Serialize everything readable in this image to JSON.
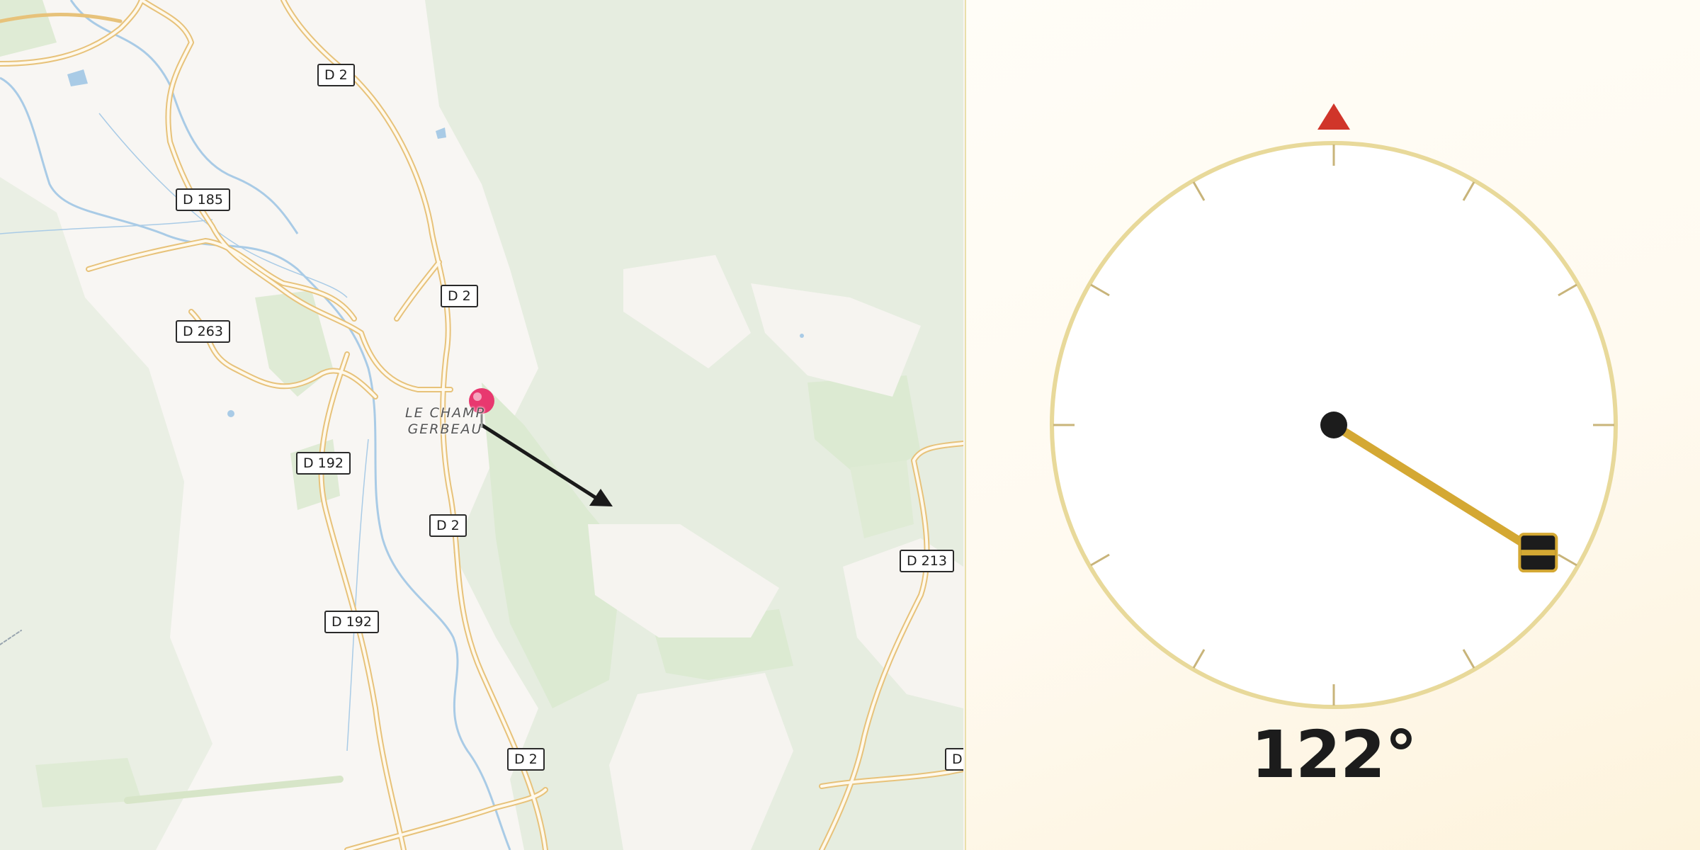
{
  "map": {
    "place_label": [
      "LE CHAMP",
      "GERBEAU"
    ],
    "road_labels": [
      {
        "id": "d2-a",
        "text": "D 2"
      },
      {
        "id": "d185",
        "text": "D 185"
      },
      {
        "id": "d2-b",
        "text": "D 2"
      },
      {
        "id": "d263",
        "text": "D 263"
      },
      {
        "id": "d192-a",
        "text": "D 192"
      },
      {
        "id": "d2-c",
        "text": "D 2"
      },
      {
        "id": "d213",
        "text": "D 213"
      },
      {
        "id": "d192-b",
        "text": "D 192"
      },
      {
        "id": "d2-d",
        "text": "D 2"
      },
      {
        "id": "d-edge",
        "text": "D"
      }
    ],
    "pin_color": "#e8386f",
    "arrow_color": "#1a1a1a"
  },
  "compass": {
    "heading_deg": 122,
    "heading_text": "122°",
    "north_marker_color": "#d0352a",
    "needle_color": "#d4a833",
    "dial_ring_color": "#e8d99a"
  }
}
